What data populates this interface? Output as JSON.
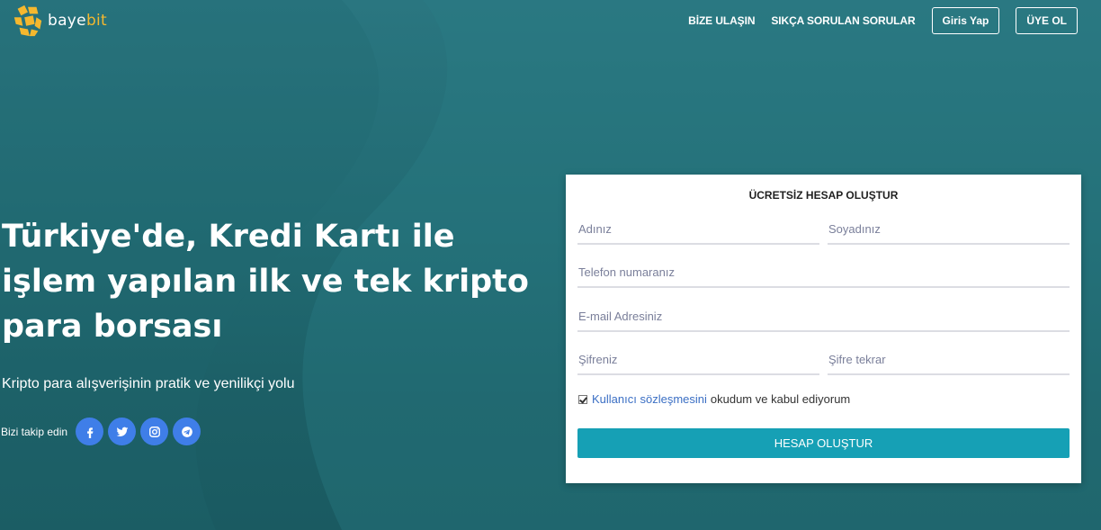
{
  "brand": {
    "name_part1": "baye",
    "name_part2": "bit",
    "accent_color": "#f5b82e",
    "logo_icon": "bayebit-logo-icon"
  },
  "nav": {
    "contact": "BİZE ULAŞIN",
    "faq": "SIKÇA SORULAN SORULAR",
    "login": "Giris Yap",
    "signup": "ÜYE OL"
  },
  "hero": {
    "title": "Türkiye'de, Kredi Kartı ile işlem yapılan ilk ve tek kripto para borsası",
    "subtitle": "Kripto para alışverişinin pratik ve yenilikçi yolu",
    "follow_label": "Bizi takip edin",
    "social": [
      {
        "icon": "facebook-icon"
      },
      {
        "icon": "twitter-icon"
      },
      {
        "icon": "instagram-icon"
      },
      {
        "icon": "telegram-icon"
      }
    ],
    "social_color": "#3f7ee8"
  },
  "form": {
    "title": "ÜCRETSİZ HESAP OLUŞTUR",
    "first_name_placeholder": "Adınız",
    "last_name_placeholder": "Soyadınız",
    "phone_placeholder": "Telefon numaranız",
    "email_placeholder": "E-mail Adresiniz",
    "password_placeholder": "Şifreniz",
    "password_repeat_placeholder": "Şifre tekrar",
    "agreement_checked": true,
    "agreement_link": "Kullanıcı sözleşmesini",
    "agreement_text": "okudum ve kabul ediyorum",
    "submit_label": "HESAP OLUŞTUR",
    "submit_color": "#16a0b5"
  }
}
